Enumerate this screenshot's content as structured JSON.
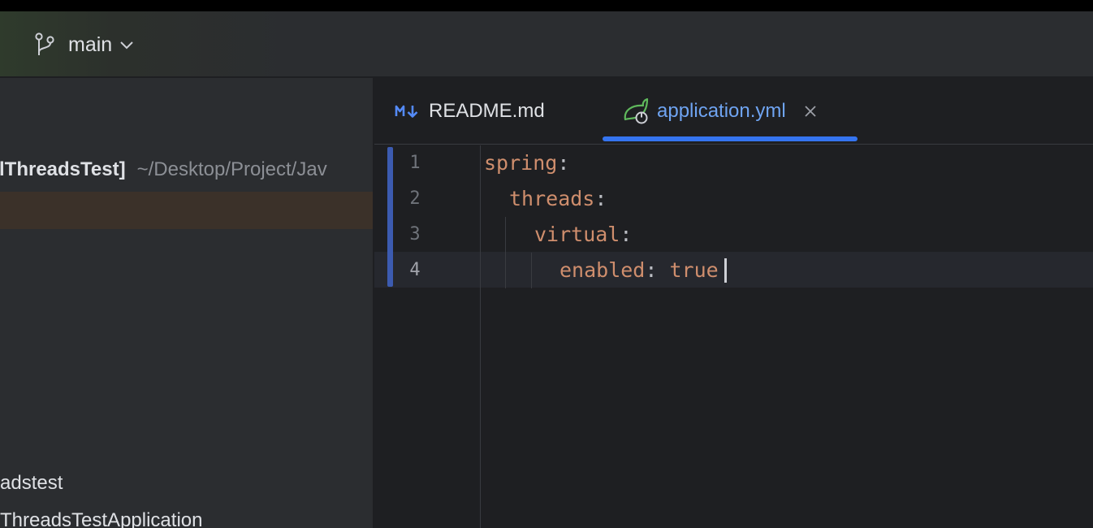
{
  "toolbar": {
    "branch_name": "main",
    "branch_icon": "git-branch-icon"
  },
  "project": {
    "root_name": "lThreadsTest]",
    "root_path": "~/Desktop/Project/Jav",
    "items": [
      {
        "label": "adstest"
      },
      {
        "label": "ThreadsTestApplication"
      }
    ]
  },
  "editor": {
    "tabs": [
      {
        "label": "README.md",
        "icon": "markdown-icon",
        "active": false
      },
      {
        "label": "application.yml",
        "icon": "spring-config-icon",
        "active": true
      }
    ],
    "lines": [
      {
        "num": "1",
        "key": "spring",
        "colon": ":",
        "value": ""
      },
      {
        "num": "2",
        "key": "threads",
        "colon": ":",
        "value": ""
      },
      {
        "num": "3",
        "key": "virtual",
        "colon": ":",
        "value": ""
      },
      {
        "num": "4",
        "key": "enabled",
        "colon": ": ",
        "value": "true"
      }
    ]
  },
  "colors": {
    "accent": "#3574f0",
    "active_tab_text": "#6fa4f2",
    "yaml_key": "#cf8e6d",
    "selection_row": "#3b3129"
  }
}
